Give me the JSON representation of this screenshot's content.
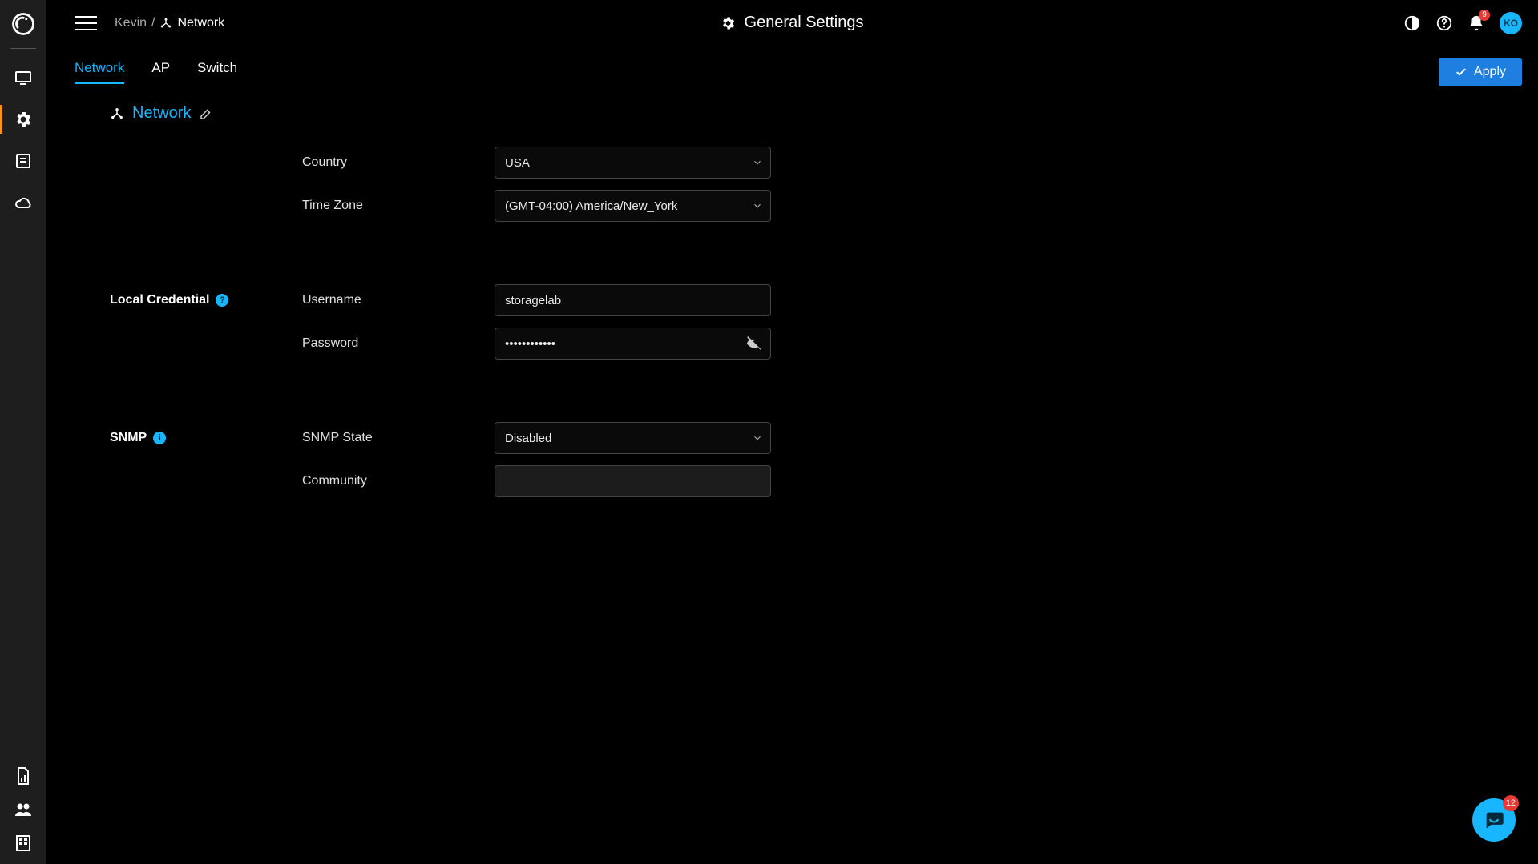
{
  "breadcrumb": {
    "user": "Kevin",
    "separator": "/",
    "network": "Network"
  },
  "page_title": "General Settings",
  "notifications_count": "9",
  "avatar_initials": "KO",
  "tabs": {
    "network": "Network",
    "ap": "AP",
    "switch": "Switch"
  },
  "apply_label": "Apply",
  "section": {
    "title": "Network"
  },
  "fields": {
    "country_label": "Country",
    "country_value": "USA",
    "tz_label": "Time Zone",
    "tz_value": "(GMT-04:00) America/New_York",
    "local_cred_label": "Local Credential",
    "username_label": "Username",
    "username_value": "storagelab",
    "password_label": "Password",
    "password_value": "••••••••••••",
    "snmp_label": "SNMP",
    "snmp_state_label": "SNMP State",
    "snmp_state_value": "Disabled",
    "community_label": "Community",
    "community_value": ""
  },
  "chat_count": "12"
}
